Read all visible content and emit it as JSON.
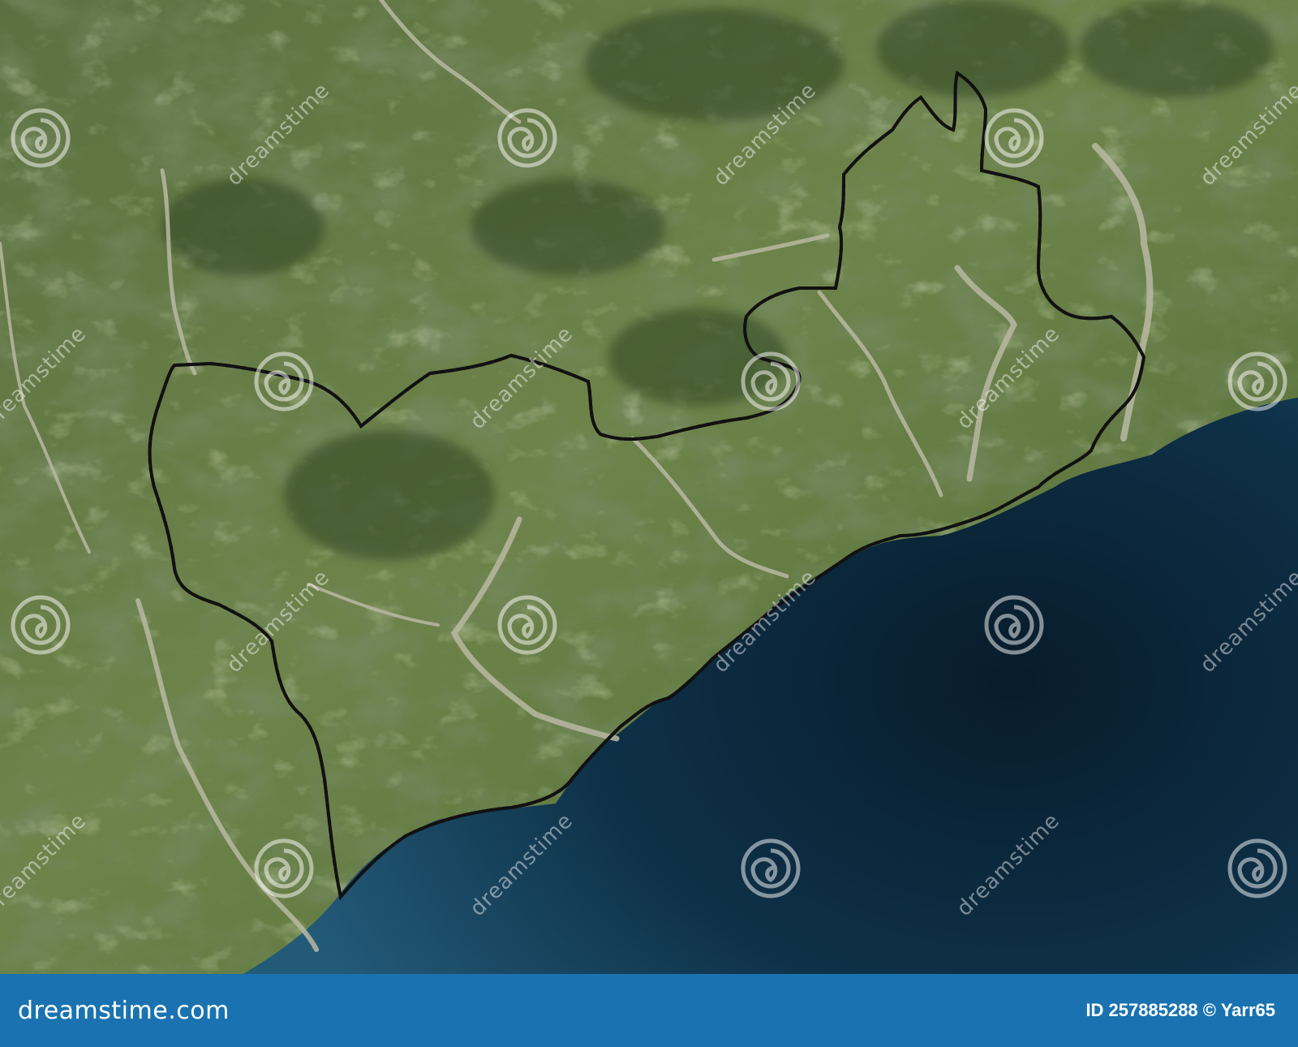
{
  "watermark": {
    "text": "dreamstime",
    "color": "#ffffff"
  },
  "footer": {
    "brand": "dreamstime.com",
    "credit": "ID 257885288 © Yarr65",
    "background": "#1a73b0"
  },
  "colors": {
    "land_dark": "#3f5a2c",
    "land_mid": "#647b45",
    "land_light": "#8fa16a",
    "riverbed": "#b7b8a0",
    "sea_shallow": "#1f5470",
    "sea_deep": "#0a2233",
    "border": "#ffffff"
  }
}
